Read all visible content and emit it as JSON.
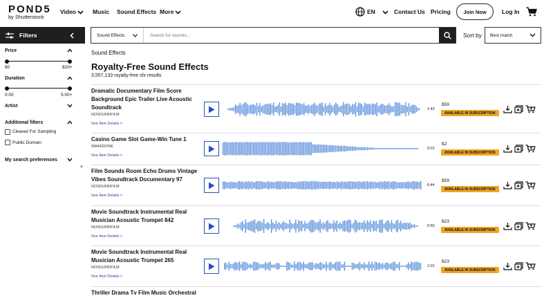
{
  "header": {
    "logo_main": "POND5",
    "logo_sub": "by Shutterstock",
    "nav": [
      {
        "label": "Video",
        "chevron": true
      },
      {
        "label": "Music",
        "chevron": false
      },
      {
        "label": "Sound Effects",
        "chevron": false
      },
      {
        "label": "More",
        "chevron": true
      }
    ],
    "language": "EN",
    "contact": "Contact Us",
    "pricing": "Pricing",
    "join": "Join Now",
    "login": "Log In"
  },
  "sidebar": {
    "filters_label": "Filters",
    "price": {
      "label": "Price",
      "min": "$0",
      "max": "$20+"
    },
    "duration": {
      "label": "Duration",
      "min": "0:00",
      "max": "5:00+"
    },
    "artist": "Artist",
    "additional": {
      "label": "Additional filters",
      "options": [
        "Cleared For Sampling",
        "Public Domain"
      ]
    },
    "prefs": "My search preferences"
  },
  "search": {
    "category": "Sound Effects",
    "placeholder": "Search for sounds...",
    "sort_label": "Sort by",
    "sort_value": "Best match"
  },
  "main": {
    "breadcrumb": "Sound Effects",
    "heading": "Royalty-Free Sound Effects",
    "count": "3,557,133 royalty-free sfx results",
    "details_label": "See Item Details >",
    "badge_label": "AVAILABLE IN SUBSCRIPTION",
    "items": [
      {
        "title": "Dramatic Documentary Film Score Background Epic Trailer Live Acoustic Soundtrack",
        "artist": "NOSOUNDFILM",
        "duration": "1:43",
        "price": "$59"
      },
      {
        "title": "Casino Game Slot Game-Win Tune 1",
        "artist": "WAKERONE",
        "duration": "0:01",
        "price": "$2"
      },
      {
        "title": "Film Sounds Room Echo Drums Vintage Vibes Soundtrack Documentary 97",
        "artist": "NOSOUNDFILM",
        "duration": "6:44",
        "price": "$59"
      },
      {
        "title": "Movie Soundtrack Instrumental Real Musician Acoustic Trumpet 842",
        "artist": "NOSOUNDFILM",
        "duration": "0:50",
        "price": "$23"
      },
      {
        "title": "Movie Soundtrack Instrumental Real Musician Acoustic Trumpet 265",
        "artist": "NOSOUNDFILM",
        "duration": "1:01",
        "price": "$23"
      },
      {
        "title": "Thriller Drama Tv Film Music Orchestral",
        "artist": "",
        "duration": "",
        "price": ""
      }
    ]
  },
  "colors": {
    "wave": "#5b8fdc",
    "badge": "#f0a526",
    "accent": "#2a4ec0",
    "dark": "#1f1f1f"
  }
}
